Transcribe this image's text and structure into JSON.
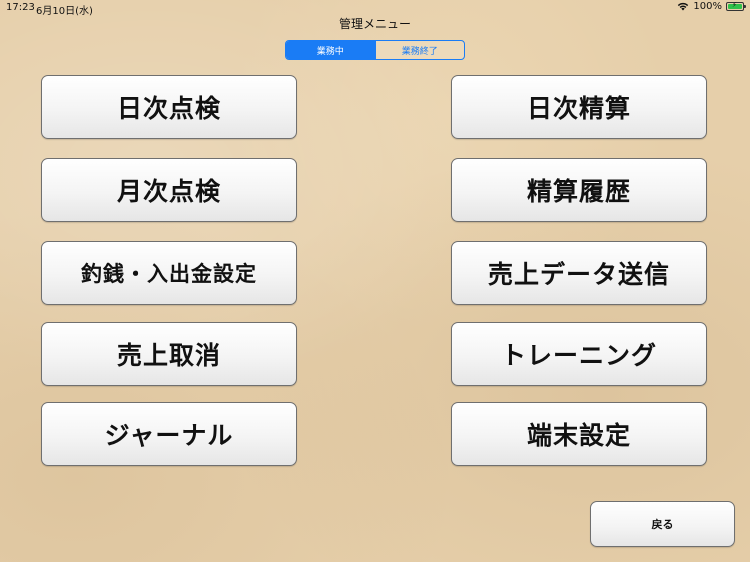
{
  "status_bar": {
    "time": "17:23",
    "date": "6月10日(水)",
    "battery": "100%",
    "battery_level": 1.0,
    "wifi_icon": "wifi-icon",
    "battery_icon": "battery-charging-icon"
  },
  "header": {
    "title": "管理メニュー"
  },
  "segmented": {
    "options": [
      "業務中",
      "業務終了"
    ],
    "selected": "業務中",
    "accent_color": "#1a7cf5"
  },
  "menu": {
    "left": [
      "日次点検",
      "月次点検",
      "釣銭・入出金設定",
      "売上取消",
      "ジャーナル"
    ],
    "right": [
      "日次精算",
      "精算履歴",
      "売上データ送信",
      "トレーニング",
      "端末設定"
    ]
  },
  "footer": {
    "back_label": "戻る"
  }
}
